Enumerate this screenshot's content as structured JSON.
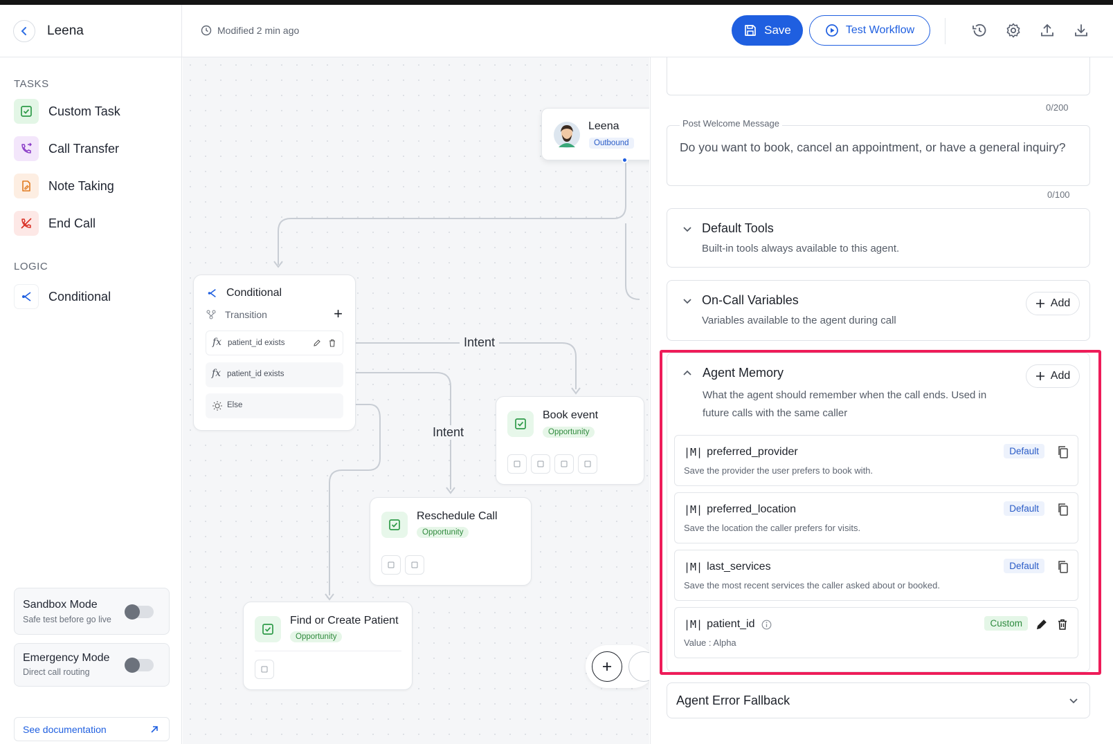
{
  "header": {
    "app_name": "Leena",
    "modified": "Modified 2 min ago",
    "save_label": "Save",
    "test_label": "Test Workflow",
    "accent": "#1f5fe0"
  },
  "sidebar": {
    "tasks_title": "TASKS",
    "tasks": [
      {
        "label": "Custom Task",
        "icon": "check-square-icon",
        "bg": "#e3f6e6"
      },
      {
        "label": "Call Transfer",
        "icon": "phone-transfer-icon",
        "bg": "#f3e6fb"
      },
      {
        "label": "Note Taking",
        "icon": "note-icon",
        "bg": "#fdeee2"
      },
      {
        "label": "End Call",
        "icon": "phone-end-icon",
        "bg": "#fde8e6"
      }
    ],
    "logic_title": "LOGIC",
    "logic": [
      {
        "label": "Conditional",
        "icon": "branch-icon"
      }
    ],
    "sandbox": {
      "title": "Sandbox Mode",
      "subtitle": "Safe test before go live"
    },
    "emergency": {
      "title": "Emergency Mode",
      "subtitle": "Direct call routing"
    },
    "doc_link": "See documentation"
  },
  "canvas": {
    "start_node": {
      "title": "Leena",
      "badge": "Outbound"
    },
    "conditional": {
      "title": "Conditional",
      "transition": "Transition",
      "rules": [
        "patient_id exists",
        "patient_id exists"
      ],
      "else": "Else"
    },
    "edge_labels": [
      "Intent",
      "Intent"
    ],
    "nodes": [
      {
        "title": "Book event",
        "badge": "Opportunity"
      },
      {
        "title": "Reschedule Call",
        "badge": "Opportunity"
      },
      {
        "title": "Find or Create Patient",
        "badge": "Opportunity"
      }
    ]
  },
  "panel": {
    "top_counter": "0/200",
    "post_welcome": {
      "label": "Post Welcome Message",
      "value": "Do you want to book, cancel an appointment, or have a general inquiry?",
      "counter": "0/100"
    },
    "default_tools": {
      "title": "Default Tools",
      "subtitle": "Built-in tools always available to this agent."
    },
    "on_call_vars": {
      "title": "On-Call Variables",
      "subtitle": "Variables available to the agent during call",
      "add": "Add"
    },
    "agent_memory": {
      "title": "Agent Memory",
      "subtitle": "What the agent should remember when the call ends.  Used in future calls with the same caller",
      "add": "Add",
      "logo": "|M|",
      "items": [
        {
          "name": "preferred_provider",
          "desc": "Save the provider the user prefers to book with.",
          "tag": "Default"
        },
        {
          "name": "preferred_location",
          "desc": "Save the location the caller prefers for visits.",
          "tag": "Default"
        },
        {
          "name": "last_services",
          "desc": "Save the most recent services the caller asked about or booked.",
          "tag": "Default"
        },
        {
          "name": "patient_id",
          "desc": "Value : Alpha",
          "tag": "Custom"
        }
      ]
    },
    "error_fallback": {
      "title": "Agent Error Fallback"
    }
  }
}
